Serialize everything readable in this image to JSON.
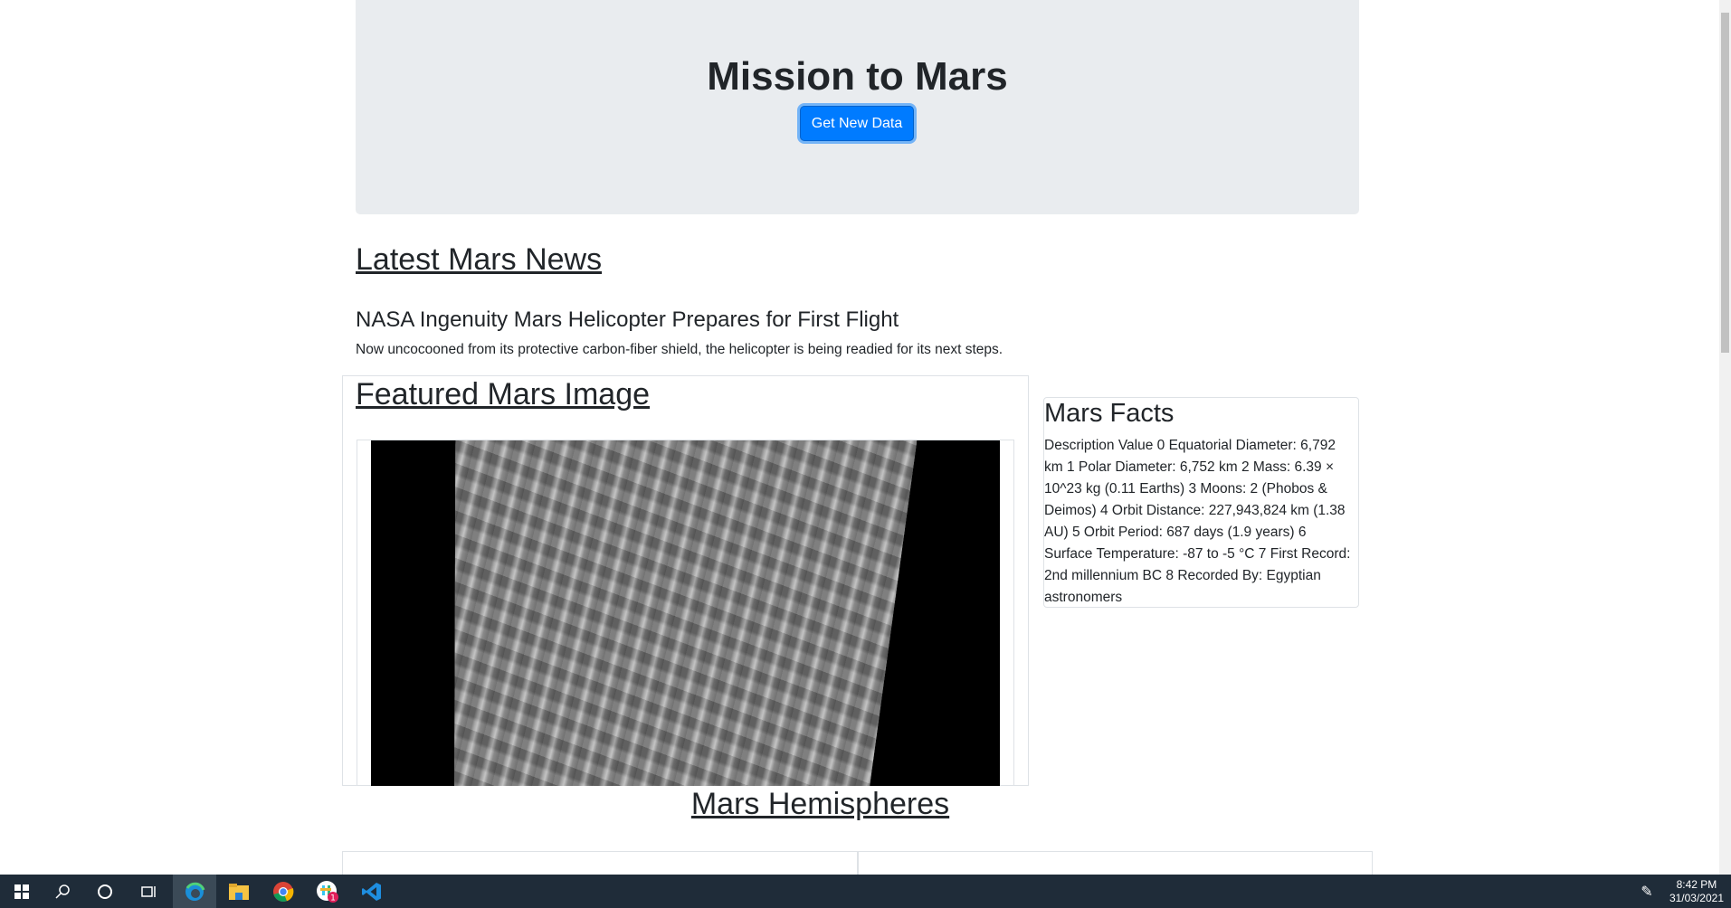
{
  "header": {
    "title": "Mission to Mars",
    "button_label": "Get New Data"
  },
  "news": {
    "heading": "Latest Mars News",
    "title": "NASA Ingenuity Mars Helicopter Prepares for First Flight",
    "teaser": "Now uncocooned from its protective carbon-fiber shield, the helicopter is being readied for its next steps."
  },
  "featured": {
    "heading": "Featured Mars Image"
  },
  "facts": {
    "heading": "Mars Facts",
    "text": "Description Value 0 Equatorial Diameter: 6,792 km 1 Polar Diameter: 6,752 km 2 Mass: 6.39 × 10^23 kg (0.11 Earths) 3 Moons: 2 (Phobos & Deimos) 4 Orbit Distance: 227,943,824 km (1.38 AU) 5 Orbit Period: 687 days (1.9 years) 6 Surface Temperature: -87 to -5 °C 7 First Record: 2nd millennium BC 8 Recorded By: Egyptian astronomers"
  },
  "hemispheres": {
    "heading": "Mars Hemispheres"
  },
  "taskbar": {
    "time": "8:42 PM",
    "date": "31/03/2021",
    "slack_badge": "1",
    "icons": [
      "windows-start-icon",
      "search-icon",
      "cortana-icon",
      "task-view-icon",
      "edge-icon",
      "file-explorer-icon",
      "chrome-icon",
      "slack-icon",
      "vscode-icon"
    ]
  },
  "colors": {
    "primary": "#007bff",
    "jumbotron": "#e9ecef",
    "taskbar": "#1f2c39"
  }
}
